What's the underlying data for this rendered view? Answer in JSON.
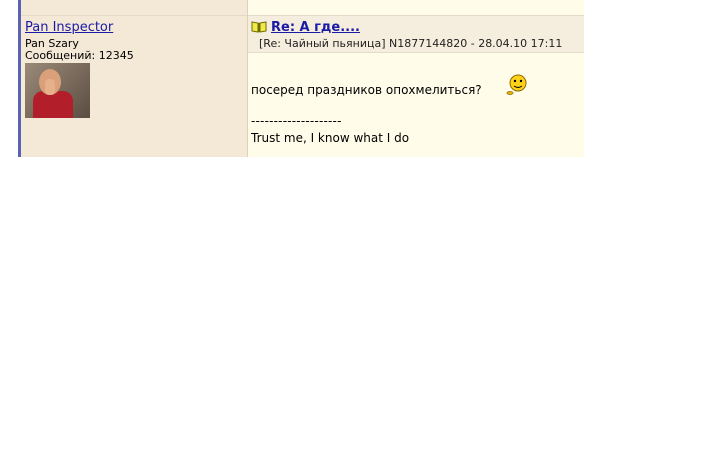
{
  "post": {
    "author": {
      "name": "Pan Inspector",
      "title": "Pan Szary",
      "posts_label": "Сообщений: 12345"
    },
    "subject": "Re: А где....",
    "meta": "[Re: Чайный пьяница]  N1877144820 - 28.04.10 17:11",
    "message": "посеред праздников опохмелиться?",
    "signature_separator": "--------------------",
    "signature": "Trust me, I know what I do"
  },
  "colors": {
    "author_bg": "#f4e8d7",
    "content_bg": "#fffdea",
    "link": "#1a1aa6",
    "frame_line": "#5a63b2"
  },
  "icons": {
    "subject_icon": "book-icon",
    "message_icon": "smiley-icon"
  }
}
